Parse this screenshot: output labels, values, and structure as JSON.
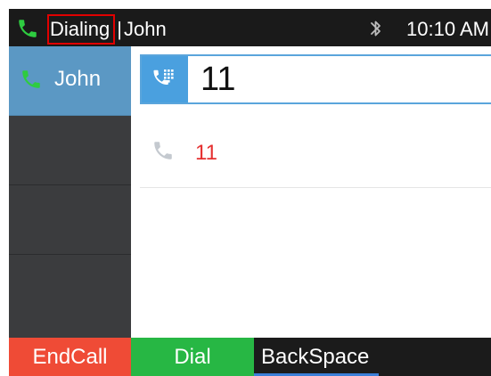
{
  "status_bar": {
    "call_state": "Dialing",
    "separator": "|",
    "contact_name": "John",
    "time": "10:10 AM"
  },
  "lines": [
    {
      "label": "John",
      "active": true,
      "icon": "phone-icon"
    },
    {
      "label": "",
      "active": false
    },
    {
      "label": "",
      "active": false
    },
    {
      "label": "",
      "active": false
    }
  ],
  "dialer": {
    "input_value": "11",
    "icon": "dialpad-phone-icon"
  },
  "suggestions": [
    {
      "number": "11",
      "icon": "phone-icon"
    }
  ],
  "softkeys": {
    "end_call": "EndCall",
    "dial": "Dial",
    "backspace": "BackSpace"
  },
  "colors": {
    "accent_blue": "#4aa0df",
    "end_call_red": "#ef4b36",
    "dial_green": "#27b744",
    "active_line_blue": "#5b98c4",
    "state_highlight_red": "#e10000",
    "suggestion_red": "#e53030"
  }
}
